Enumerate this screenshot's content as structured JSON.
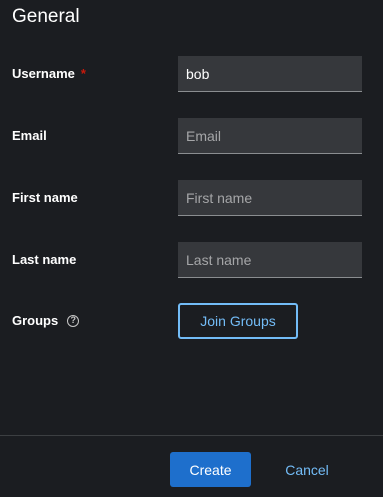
{
  "section": {
    "title": "General"
  },
  "fields": {
    "username": {
      "label": "Username",
      "required_marker": "*",
      "value": "bob",
      "placeholder": ""
    },
    "email": {
      "label": "Email",
      "value": "",
      "placeholder": "Email"
    },
    "first_name": {
      "label": "First name",
      "value": "",
      "placeholder": "First name"
    },
    "last_name": {
      "label": "Last name",
      "value": "",
      "placeholder": "Last name"
    },
    "groups": {
      "label": "Groups",
      "help_icon": "question-circle-icon",
      "help_glyph": "?",
      "button_label": "Join Groups"
    }
  },
  "footer": {
    "create_label": "Create",
    "cancel_label": "Cancel"
  },
  "colors": {
    "background": "#1b1d21",
    "input_background": "#36383c",
    "primary": "#1e6fcc",
    "link": "#73bcf7",
    "required": "#c9190b"
  }
}
